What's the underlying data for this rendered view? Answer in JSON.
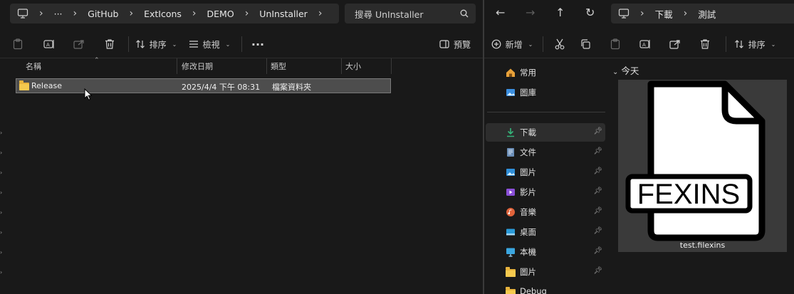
{
  "left": {
    "breadcrumb": [
      "GitHub",
      "ExtIcons",
      "DEMO",
      "UnInstaller"
    ],
    "overflow": "···",
    "search_placeholder": "搜尋 UnInstaller",
    "toolbar": {
      "sort_label": "排序",
      "view_label": "檢視",
      "more_label": "···",
      "preview_label": "預覽"
    },
    "columns": [
      "名稱",
      "修改日期",
      "類型",
      "大小"
    ],
    "rows": [
      {
        "name": "Release",
        "modified": "2025/4/4 下午 08:31",
        "type": "檔案資料夾",
        "size": ""
      }
    ]
  },
  "right": {
    "breadcrumb": [
      "下載",
      "測試"
    ],
    "toolbar": {
      "new_label": "新增",
      "sort_label": "排序"
    },
    "sidebar": [
      {
        "label": "常用",
        "icon": "home-icon",
        "color": "#e8a23a",
        "pinned": false
      },
      {
        "label": "圖庫",
        "icon": "gallery-icon",
        "color": "#3b8fe0",
        "pinned": false
      },
      {
        "label": "下載",
        "icon": "download-icon",
        "color": "#35b47a",
        "pinned": true
      },
      {
        "label": "文件",
        "icon": "document-icon",
        "color": "#6c8fb8",
        "pinned": true
      },
      {
        "label": "圖片",
        "icon": "pictures-icon",
        "color": "#2f8fd8",
        "pinned": true
      },
      {
        "label": "影片",
        "icon": "videos-icon",
        "color": "#8a4fd8",
        "pinned": true
      },
      {
        "label": "音樂",
        "icon": "music-icon",
        "color": "#e0633a",
        "pinned": true
      },
      {
        "label": "桌面",
        "icon": "desktop-icon",
        "color": "#2a9ad8",
        "pinned": true
      },
      {
        "label": "本機",
        "icon": "computer-icon",
        "color": "#3aa6e0",
        "pinned": true
      },
      {
        "label": "圖片",
        "icon": "folder-icon",
        "color": "#e8b33d",
        "pinned": true
      },
      {
        "label": "Debug",
        "icon": "folder-icon",
        "color": "#e8b33d",
        "pinned": false
      }
    ],
    "group_label": "今天",
    "file": {
      "name": "test.filexins",
      "icon_text": "FEXINS"
    }
  }
}
